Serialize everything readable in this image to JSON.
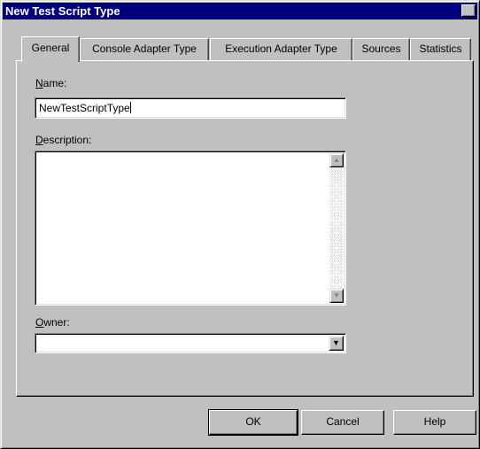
{
  "window": {
    "title": "New Test Script Type",
    "close_glyph": "✕"
  },
  "tabs": [
    {
      "label": "General",
      "active": true
    },
    {
      "label": "Console Adapter Type",
      "active": false
    },
    {
      "label": "Execution Adapter Type",
      "active": false
    },
    {
      "label": "Sources",
      "active": false
    },
    {
      "label": "Statistics",
      "active": false
    }
  ],
  "form": {
    "name_label_accel": "N",
    "name_label_rest": "ame:",
    "name_value": "NewTestScriptType",
    "description_label_accel": "D",
    "description_label_rest": "escription:",
    "description_value": "",
    "owner_label_accel": "O",
    "owner_label_rest": "wner:",
    "owner_value": ""
  },
  "icons": {
    "scroll_up": "▲",
    "scroll_down": "▼",
    "combo_arrow": "▼"
  },
  "buttons": {
    "ok": "OK",
    "cancel": "Cancel",
    "help": "Help"
  },
  "colors": {
    "titlebar": "#000080",
    "face": "#c0c0c0"
  }
}
